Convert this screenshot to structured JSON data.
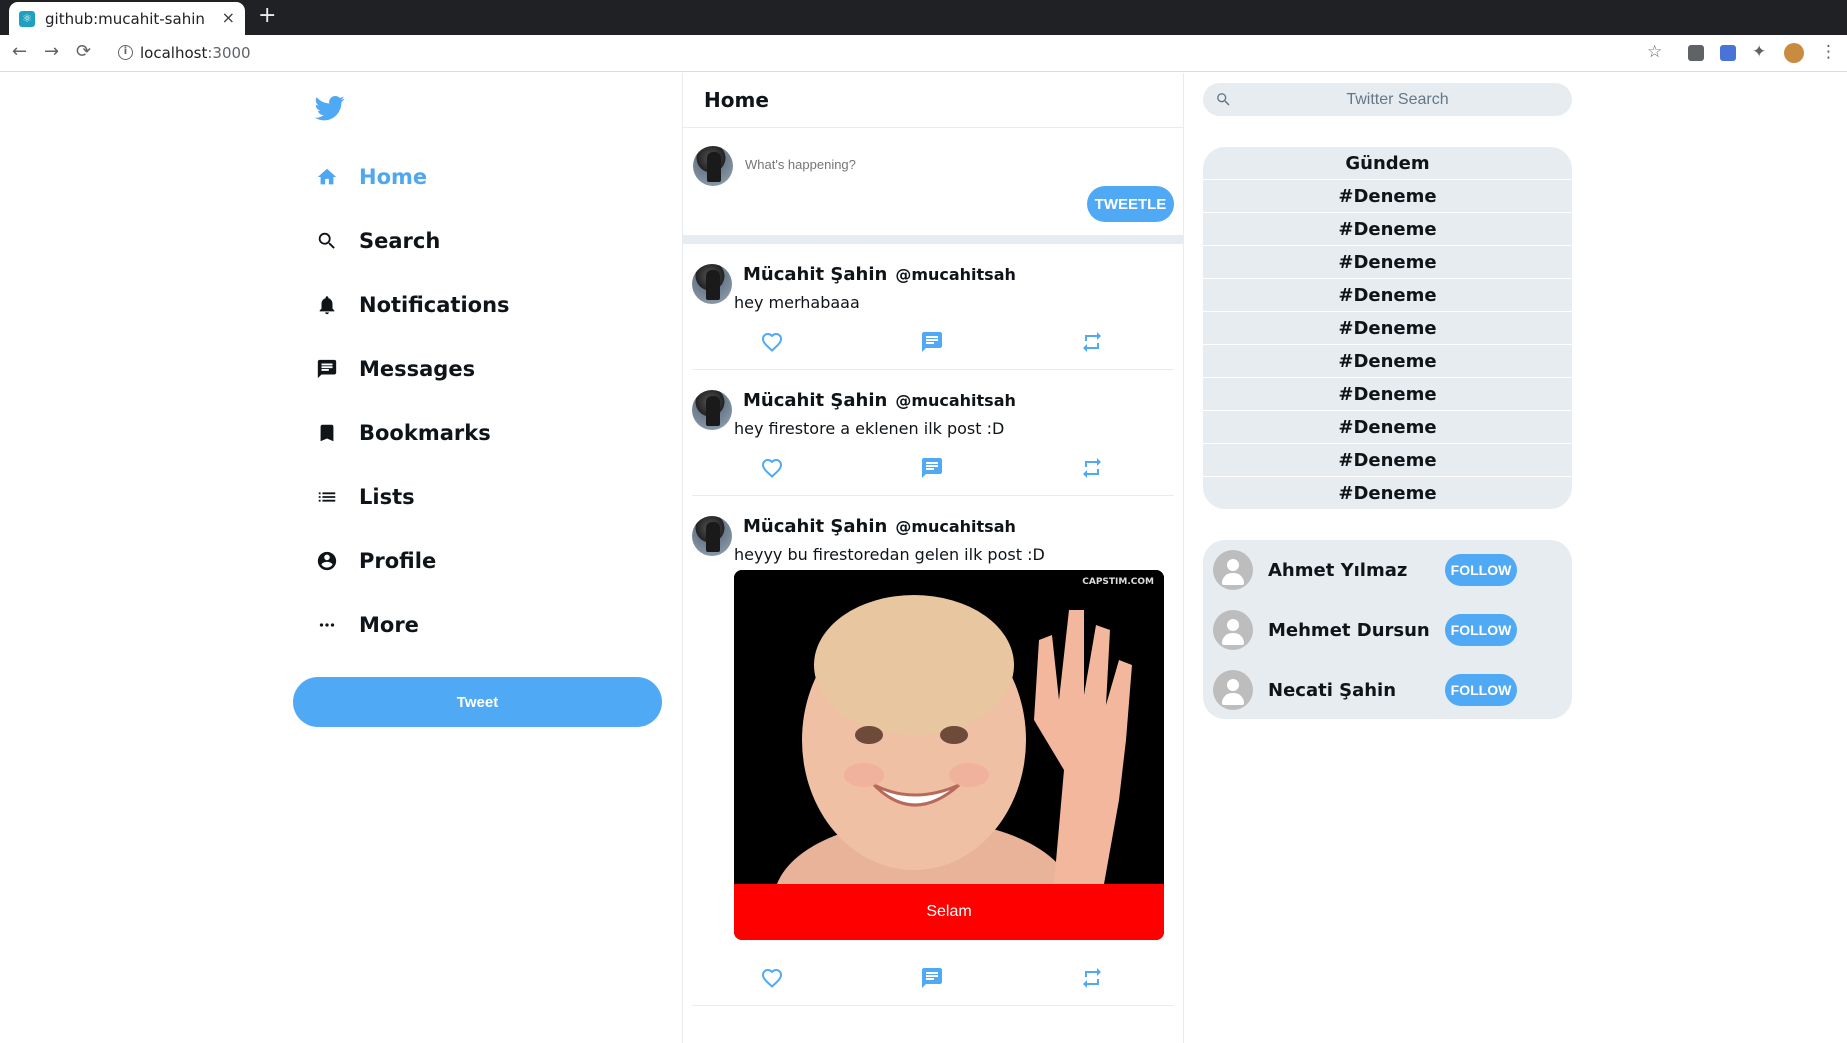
{
  "browser": {
    "tab_title": "github:mucahit-sahin",
    "tab_close": "×",
    "new_tab": "+",
    "url_host": "localhost",
    "url_port": ":3000",
    "info": "i"
  },
  "sidebar": {
    "items": [
      {
        "label": "Home",
        "icon": "home-icon",
        "active": true
      },
      {
        "label": "Search",
        "icon": "search-icon"
      },
      {
        "label": "Notifications",
        "icon": "bell-icon"
      },
      {
        "label": "Messages",
        "icon": "message-icon"
      },
      {
        "label": "Bookmarks",
        "icon": "bookmark-icon"
      },
      {
        "label": "Lists",
        "icon": "list-icon"
      },
      {
        "label": "Profile",
        "icon": "account-circle-icon"
      },
      {
        "label": "More",
        "icon": "more-icon"
      }
    ],
    "tweet_button": "Tweet"
  },
  "feed": {
    "title": "Home",
    "composer": {
      "placeholder": "What's happening?",
      "button": "TWEETLE"
    },
    "posts": [
      {
        "name": "Mücahit Şahin",
        "handle": "@mucahitsah",
        "text": "hey merhabaaa"
      },
      {
        "name": "Mücahit Şahin",
        "handle": "@mucahitsah",
        "text": "hey firestore a eklenen ilk post :D"
      },
      {
        "name": "Mücahit Şahin",
        "handle": "@mucahitsah",
        "text": "heyyy bu firestoredan gelen ilk post :D",
        "image_caption": "Selam",
        "image_watermark": "CAPSTIM.COM"
      }
    ]
  },
  "right": {
    "search_placeholder": "Twitter Search",
    "trends_title": "Gündem",
    "trends": [
      "#Deneme",
      "#Deneme",
      "#Deneme",
      "#Deneme",
      "#Deneme",
      "#Deneme",
      "#Deneme",
      "#Deneme",
      "#Deneme",
      "#Deneme"
    ],
    "who_to_follow": [
      {
        "name": "Ahmet Yılmaz",
        "button": "FOLLOW"
      },
      {
        "name": "Mehmet Dursun",
        "button": "FOLLOW"
      },
      {
        "name": "Necati Şahin",
        "button": "FOLLOW"
      }
    ]
  },
  "colors": {
    "accent": "#50a9f4",
    "panel": "#e6ecf0",
    "caption_bar": "#ff0000"
  }
}
